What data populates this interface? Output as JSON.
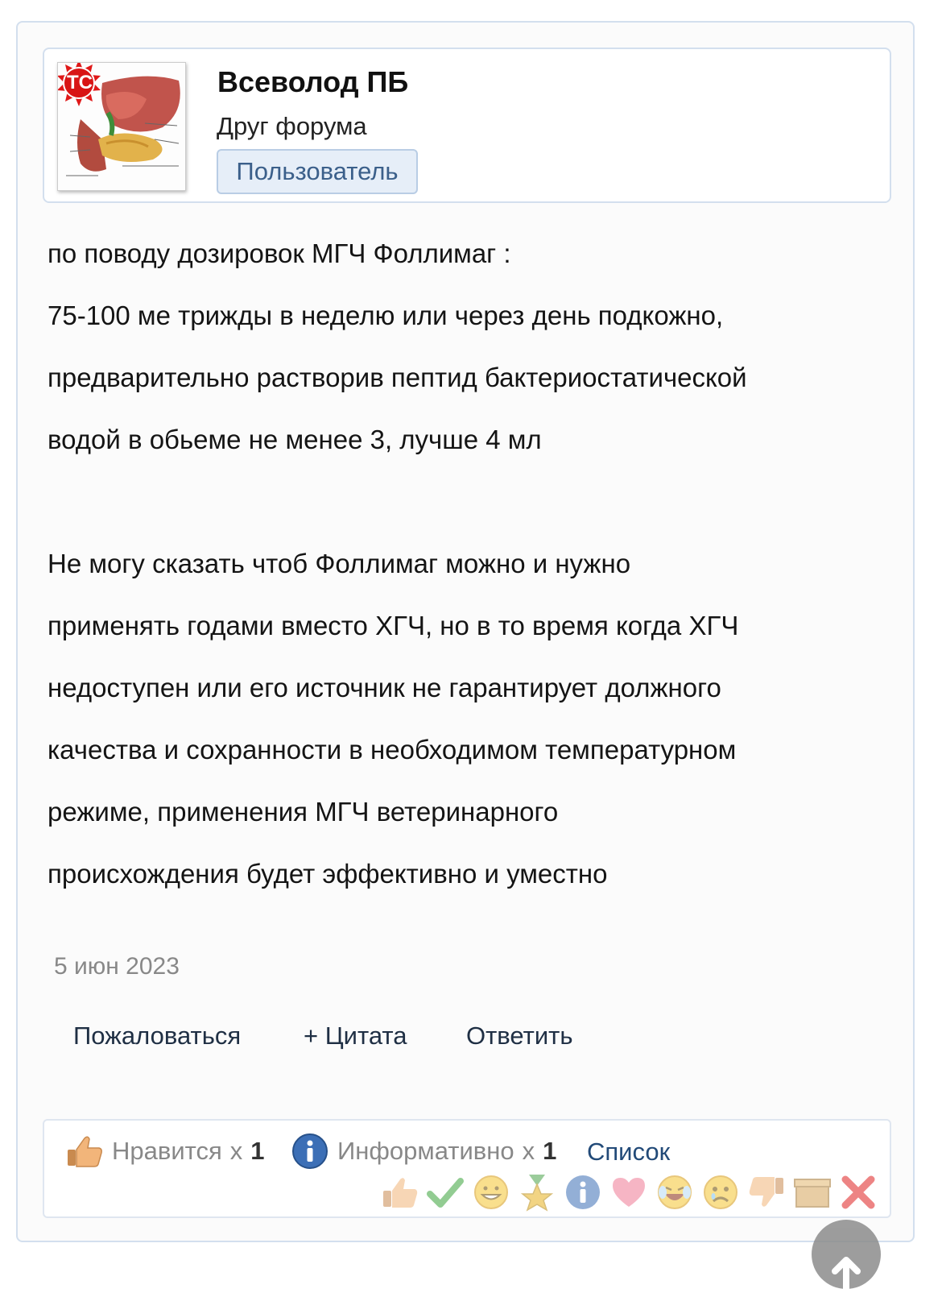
{
  "post": {
    "author": {
      "name": "Всеволод ПБ",
      "title": "Друг форума",
      "banner": "Пользователь",
      "avatar_badge": "ТС"
    },
    "message": {
      "paragraphs": [
        [
          "по поводу дозировок МГЧ Фоллимаг :",
          "75-100 ме трижды в неделю или через день подкожно,",
          "предварительно растворив пептид бактериостатической",
          "водой в обьеме не менее 3, лучше 4 мл"
        ],
        [
          "Не могу сказать чтоб Фоллимаг можно и нужно",
          "применять годами вместо ХГЧ, но в то время когда ХГЧ",
          "недоступен или его источник не гарантирует должного",
          "качества и сохранности в необходимом температурном",
          "режиме, применения МГЧ ветеринарного",
          "происхождения будет эффективно и уместно"
        ]
      ]
    },
    "date": "5 июн 2023",
    "actions": {
      "report": "Пожаловаться",
      "quote": "+ Цитата",
      "reply": "Ответить"
    },
    "ratings": {
      "summary": [
        {
          "icon": "thumbs-up-icon",
          "label": "Нравится",
          "times": "x",
          "count": "1"
        },
        {
          "icon": "info-icon",
          "label": "Информативно",
          "times": "x",
          "count": "1"
        }
      ],
      "list_link": "Список",
      "rate_icons": [
        "thumbs-up-icon",
        "check-icon",
        "smile-icon",
        "award-icon",
        "info-icon",
        "heart-icon",
        "laugh-icon",
        "sad-icon",
        "thumbs-down-icon",
        "box-icon",
        "close-icon"
      ]
    }
  }
}
